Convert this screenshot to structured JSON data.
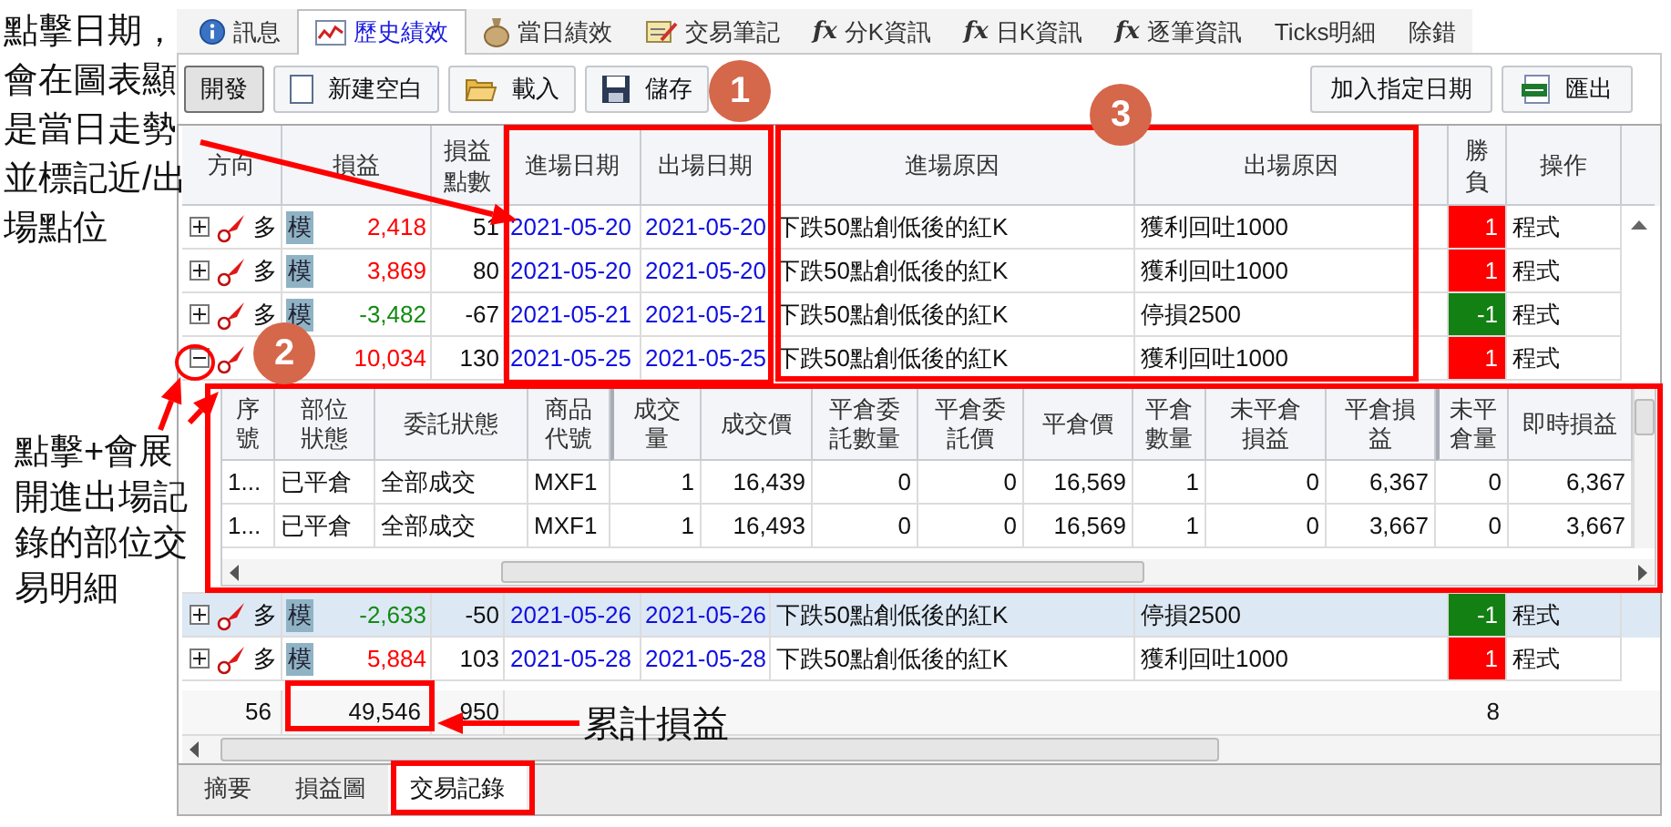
{
  "tabs": [
    {
      "label": "訊息",
      "selected": false
    },
    {
      "label": "歷史績效",
      "selected": true
    },
    {
      "label": "當日績效",
      "selected": false
    },
    {
      "label": "交易筆記",
      "selected": false
    },
    {
      "label": "分K資訊",
      "prefix": "fx",
      "selected": false
    },
    {
      "label": "日K資訊",
      "prefix": "fx",
      "selected": false
    },
    {
      "label": "逐筆資訊",
      "prefix": "fx",
      "selected": false
    },
    {
      "label": "Ticks明細",
      "selected": false
    },
    {
      "label": "除錯",
      "selected": false
    }
  ],
  "toolbar": {
    "left": [
      {
        "label": "開發",
        "pressed": true
      },
      {
        "label": "新建空白",
        "pressed": false
      },
      {
        "label": "載入",
        "pressed": false
      },
      {
        "label": "儲存",
        "pressed": false
      }
    ],
    "right": [
      {
        "label": "加入指定日期",
        "pressed": false
      },
      {
        "label": "匯出",
        "pressed": false
      }
    ]
  },
  "table": {
    "columns": [
      "方向",
      "損益",
      "損益點數",
      "進場日期",
      "出場日期",
      "進場原因",
      "出場原因",
      "勝負",
      "操作"
    ],
    "rows": [
      {
        "expanded": false,
        "selected": false,
        "direction": "多",
        "tag": "模",
        "pnl": "2,418",
        "points": "51",
        "entry_date": "2021-05-20",
        "exit_date": "2021-05-20",
        "entry_reason": "下跌50點創低後的紅K",
        "exit_reason": "獲利回吐1000",
        "win": true,
        "result": "1",
        "action": "程式"
      },
      {
        "expanded": false,
        "selected": false,
        "direction": "多",
        "tag": "模",
        "pnl": "3,869",
        "points": "80",
        "entry_date": "2021-05-20",
        "exit_date": "2021-05-20",
        "entry_reason": "下跌50點創低後的紅K",
        "exit_reason": "獲利回吐1000",
        "win": true,
        "result": "1",
        "action": "程式"
      },
      {
        "expanded": false,
        "selected": false,
        "direction": "多",
        "tag": "模",
        "pnl": "-3,482",
        "points": "-67",
        "entry_date": "2021-05-21",
        "exit_date": "2021-05-21",
        "entry_reason": "下跌50點創低後的紅K",
        "exit_reason": "停損2500",
        "win": false,
        "result": "-1",
        "action": "程式"
      },
      {
        "expanded": true,
        "selected": false,
        "pnl": "10,034",
        "points": "130",
        "entry_date": "2021-05-25",
        "exit_date": "2021-05-25",
        "entry_reason": "下跌50點創低後的紅K",
        "exit_reason": "獲利回吐1000",
        "win": true,
        "result": "1",
        "action": "程式",
        "details": {
          "columns": [
            "序號",
            "部位狀態",
            "委託狀態",
            "商品代號",
            "成交量",
            "成交價",
            "平倉委託數量",
            "平倉委託價",
            "平倉價",
            "平倉數量",
            "未平倉損益",
            "平倉損益",
            "未平倉量",
            "即時損益"
          ],
          "rows": [
            [
              "1...",
              "已平倉",
              "全部成交",
              "MXF1",
              "1",
              "16,439",
              "0",
              "0",
              "16,569",
              "1",
              "0",
              "6,367",
              "0",
              "6,367"
            ],
            [
              "1...",
              "已平倉",
              "全部成交",
              "MXF1",
              "1",
              "16,493",
              "0",
              "0",
              "16,569",
              "1",
              "0",
              "3,667",
              "0",
              "3,667"
            ]
          ]
        }
      },
      {
        "expanded": false,
        "selected": true,
        "direction": "多",
        "tag": "模",
        "pnl": "-2,633",
        "points": "-50",
        "entry_date": "2021-05-26",
        "exit_date": "2021-05-26",
        "entry_reason": "下跌50點創低後的紅K",
        "exit_reason": "停損2500",
        "win": false,
        "result": "-1",
        "action": "程式"
      },
      {
        "expanded": false,
        "selected": false,
        "direction": "多",
        "tag": "模",
        "pnl": "5,884",
        "points": "103",
        "entry_date": "2021-05-28",
        "exit_date": "2021-05-28",
        "entry_reason": "下跌50點創低後的紅K",
        "exit_reason": "獲利回吐1000",
        "win": true,
        "result": "1",
        "action": "程式"
      }
    ],
    "footer": {
      "count": "56",
      "pnl": "49,546",
      "points": "950",
      "wins": "8"
    }
  },
  "bottom_tabs": [
    {
      "label": "摘要",
      "selected": false
    },
    {
      "label": "損益圖",
      "selected": false
    },
    {
      "label": "交易記錄",
      "selected": true
    }
  ],
  "annotations": {
    "date_note": "點擊日期，會在圖表顯是當日走勢並標記近/出場點位",
    "expand_note": "點擊+會展開進出場記錄的部位交易明細",
    "total_note": "累計損益",
    "markers": [
      "1",
      "2",
      "3"
    ]
  }
}
